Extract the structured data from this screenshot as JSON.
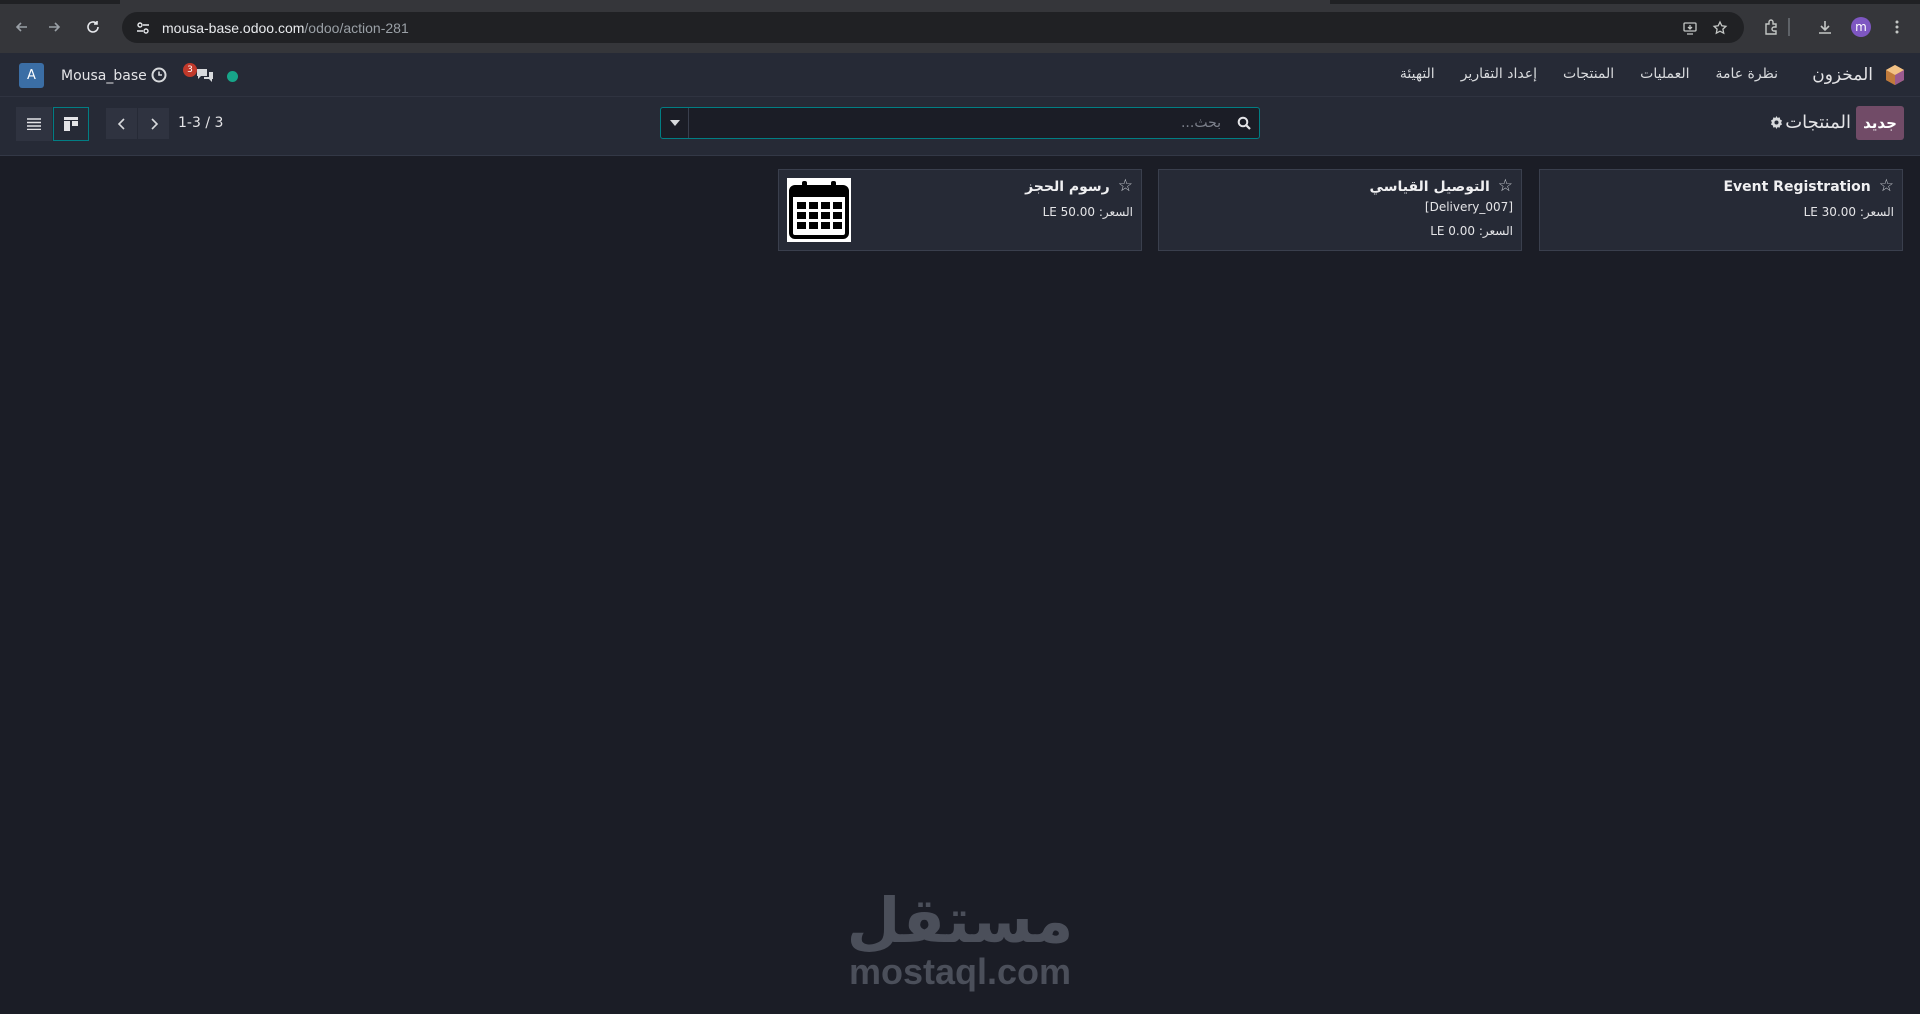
{
  "browser": {
    "url_host": "mousa-base.odoo.com",
    "url_path": "/odoo/action-281",
    "profile_initial": "m"
  },
  "navbar": {
    "app_name": "المخزون",
    "menu": [
      "نظرة عامة",
      "العمليات",
      "المنتجات",
      "إعداد التقارير",
      "التهيئة"
    ],
    "company_initial": "A",
    "database_name": "Mousa_base",
    "message_count": "3"
  },
  "control_panel": {
    "new_label": "جديد",
    "title": "المنتجات",
    "search_placeholder": "بحث...",
    "pager_value": "1-3 / 3"
  },
  "products": [
    {
      "name": "Event Registration",
      "price_line": "السعر: LE 30.00"
    },
    {
      "name": "التوصيل القياسي",
      "reference": "[Delivery_007]",
      "price_line": "السعر: LE 0.00"
    },
    {
      "name": "رسوم الحجز",
      "price_line": "السعر: LE 50.00",
      "image": "calendar-icon"
    }
  ],
  "watermark": {
    "arabic": "مستقل",
    "latin": "mostaql.com"
  },
  "colors": {
    "accent": "#714b67",
    "teal": "#017e84",
    "background": "#1b1d26",
    "panel": "#262a36",
    "presence": "#17a589",
    "badge": "#c0392b"
  }
}
